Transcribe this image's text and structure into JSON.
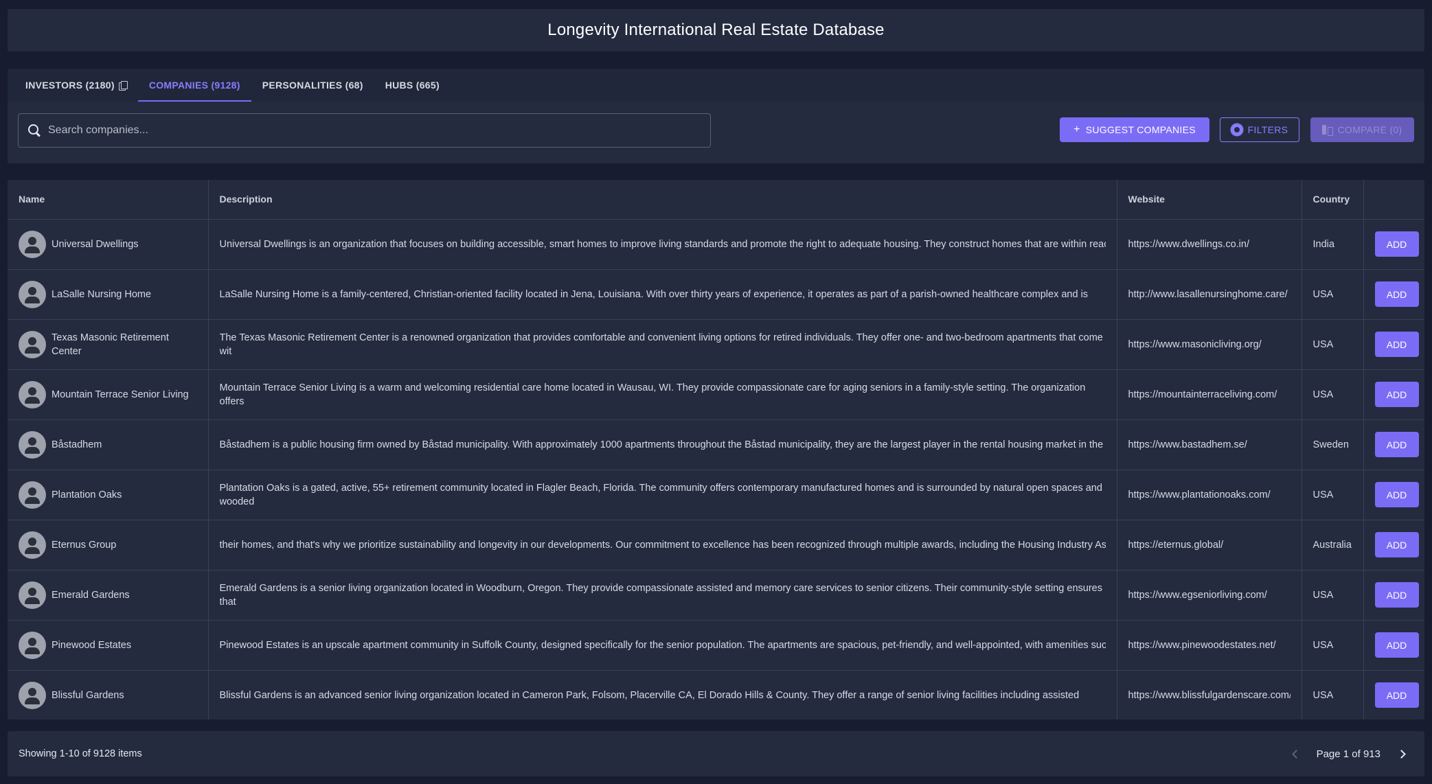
{
  "app": {
    "title": "Longevity International Real Estate Database"
  },
  "tabs": [
    {
      "label": "INVESTORS (2180)"
    },
    {
      "label": "COMPANIES (9128)"
    },
    {
      "label": "PERSONALITIES (68)"
    },
    {
      "label": "HUBS (665)"
    }
  ],
  "search": {
    "placeholder": "Search companies...",
    "value": ""
  },
  "toolbar": {
    "suggest_label": "SUGGEST COMPANIES",
    "filters_label": "FILTERS",
    "compare_label": "COMPARE (0)"
  },
  "table": {
    "columns": [
      "Name",
      "Description",
      "Website",
      "Country",
      ""
    ],
    "add_label": "ADD",
    "rows": [
      {
        "name": "Universal Dwellings",
        "description": "Universal Dwellings is an organization that focuses on building accessible, smart homes to improve living standards and promote the right to adequate housing. They construct homes that are within reac",
        "website": "https://www.dwellings.co.in/",
        "country": "India"
      },
      {
        "name": "LaSalle Nursing Home",
        "description": "LaSalle Nursing Home is a family-centered, Christian-oriented facility located in Jena, Louisiana. With over thirty years of experience, it operates as part of a parish-owned healthcare complex and is",
        "website": "http://www.lasallenursinghome.care/",
        "country": "USA"
      },
      {
        "name": "Texas Masonic Retirement Center",
        "description": "The Texas Masonic Retirement Center is a renowned organization that provides comfortable and convenient living options for retired individuals. They offer one- and two-bedroom apartments that come wit",
        "website": "https://www.masonicliving.org/",
        "country": "USA"
      },
      {
        "name": "Mountain Terrace Senior Living",
        "description": "Mountain Terrace Senior Living is a warm and welcoming residential care home located in Wausau, WI. They provide compassionate care for aging seniors in a family-style setting. The organization offers",
        "website": "https://mountainterraceliving.com/",
        "country": "USA"
      },
      {
        "name": "Båstadhem",
        "description": "Båstadhem is a public housing firm owned by Båstad municipality. With approximately 1000 apartments throughout the Båstad municipality, they are the largest player in the rental housing market in the",
        "website": "https://www.bastadhem.se/",
        "country": "Sweden"
      },
      {
        "name": "Plantation Oaks",
        "description": "Plantation Oaks is a gated, active, 55+ retirement community located in Flagler Beach, Florida. The community offers contemporary manufactured homes and is surrounded by natural open spaces and wooded",
        "website": "https://www.plantationoaks.com/",
        "country": "USA"
      },
      {
        "name": "Eternus Group",
        "description": "their homes, and that's why we prioritize sustainability and longevity in our developments. Our commitment to excellence has been recognized through multiple awards, including the Housing Industry Ass",
        "website": "https://eternus.global/",
        "country": "Australia"
      },
      {
        "name": "Emerald Gardens",
        "description": "Emerald Gardens is a senior living organization located in Woodburn, Oregon. They provide compassionate assisted and memory care services to senior citizens. Their community-style setting ensures that",
        "website": "https://www.egseniorliving.com/",
        "country": "USA"
      },
      {
        "name": "Pinewood Estates",
        "description": "Pinewood Estates is an upscale apartment community in Suffolk County, designed specifically for the senior population. The apartments are spacious, pet-friendly, and well-appointed, with amenities suc",
        "website": "https://www.pinewoodestates.net/",
        "country": "USA"
      },
      {
        "name": "Blissful Gardens",
        "description": "Blissful Gardens is an advanced senior living organization located in Cameron Park, Folsom, Placerville CA, El Dorado Hills & County. They offer a range of senior living facilities including assisted",
        "website": "https://www.blissfulgardenscare.com/",
        "country": "USA"
      }
    ]
  },
  "footer": {
    "showing": "Showing 1-10 of 9128 items",
    "page": "Page 1 of 913"
  },
  "colors": {
    "accent": "#7b6cf6",
    "background": "#171d2e",
    "panel": "#242b3f"
  }
}
